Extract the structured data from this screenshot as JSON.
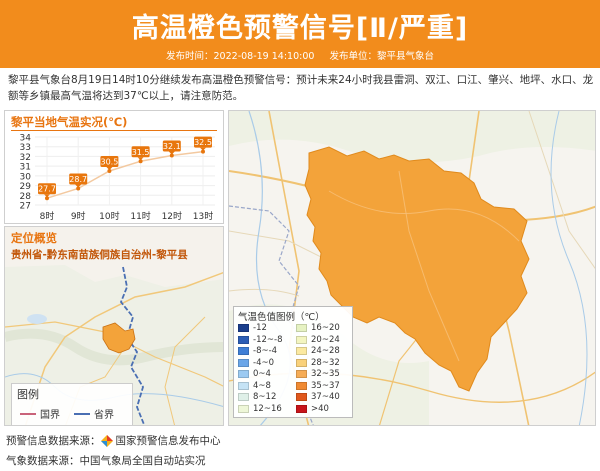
{
  "header": {
    "title": "高温橙色预警信号[Ⅱ/严重]",
    "publish_time_label": "发布时间：2022-08-19 14:10:00",
    "publisher_label": "发布单位：黎平县气象台"
  },
  "body_text": "黎平县气象台8月19日14时10分继续发布高温橙色预警信号：预计未来24小时我县雷洞、双江、口江、肇兴、地坪、水口、龙额等乡镇最高气温将达到37℃以上，请注意防范。",
  "chart_panel": {
    "title": "黎平当地气温实况(℃)"
  },
  "chart_data": {
    "type": "line",
    "title": "黎平当地气温实况(℃)",
    "x": [
      "8时",
      "9时",
      "10时",
      "11时",
      "12时",
      "13时"
    ],
    "y": [
      27.7,
      28.7,
      30.5,
      31.5,
      32.1,
      32.5
    ],
    "ylim": [
      27,
      34
    ],
    "yticks": [
      27,
      28,
      29,
      30,
      31,
      32,
      33,
      34
    ],
    "data_labels": [
      "27.7",
      "28.7",
      "30.5",
      "31.5",
      "32.1",
      "32.5"
    ],
    "grid": true,
    "colors": {
      "line": "#f3c9a0",
      "marker": "#e8760d",
      "label_bg": "#e8760d"
    }
  },
  "location_panel": {
    "title": "定位概览",
    "region": "贵州省-黔东南苗族侗族自治州-黎平县"
  },
  "map_legend": {
    "title": "图例",
    "items": [
      {
        "label": "国界",
        "color": "#c9637a"
      },
      {
        "label": "省界",
        "color": "#4a6fb3"
      }
    ]
  },
  "temp_legend": {
    "title": "气温色值图例（℃）",
    "items": [
      {
        "label": "-12",
        "color": "#1a3e8c"
      },
      {
        "label": "16~20",
        "color": "#e6f2c2"
      },
      {
        "label": "-12~-8",
        "color": "#2b5db5"
      },
      {
        "label": "20~24",
        "color": "#f3f5c0"
      },
      {
        "label": "-8~-4",
        "color": "#3f7fd6"
      },
      {
        "label": "24~28",
        "color": "#fbe9a0"
      },
      {
        "label": "-4~0",
        "color": "#6aa6e8"
      },
      {
        "label": "28~32",
        "color": "#f9d17a"
      },
      {
        "label": "0~4",
        "color": "#9ccaf1"
      },
      {
        "label": "32~35",
        "color": "#f6ac55"
      },
      {
        "label": "4~8",
        "color": "#c5e3f5"
      },
      {
        "label": "35~37",
        "color": "#f08a32"
      },
      {
        "label": "8~12",
        "color": "#dff0e8"
      },
      {
        "label": "37~40",
        "color": "#e0581c"
      },
      {
        "label": "12~16",
        "color": "#eef7d8"
      },
      {
        "label": ">40",
        "color": "#c8151b"
      }
    ]
  },
  "footer": {
    "warning_source_label": "预警信息数据来源：",
    "warning_source_value": "国家预警信息发布中心",
    "weather_source_label": "气象数据来源：",
    "weather_source_value": "中国气象局全国自动站实况"
  },
  "colors": {
    "header": "#f28c1c",
    "accent": "#e87511",
    "county_fill": "#f3a33a"
  }
}
